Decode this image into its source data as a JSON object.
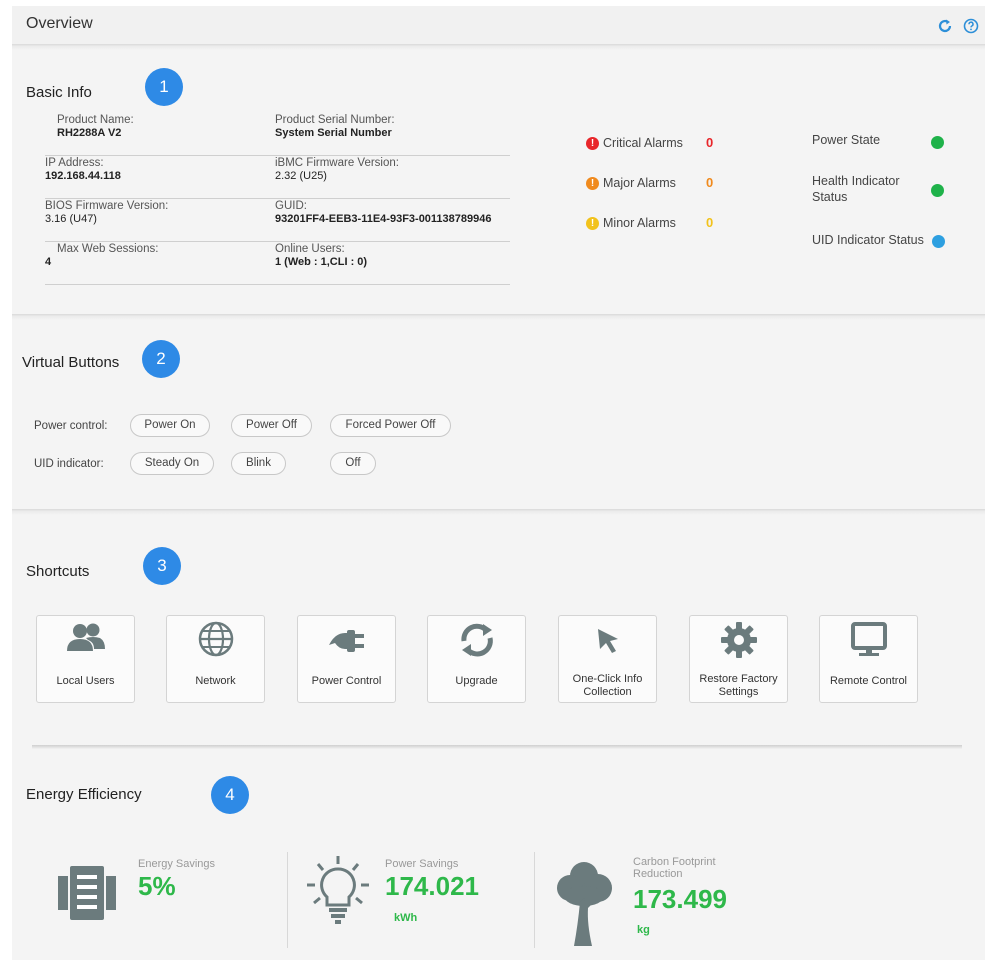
{
  "header": {
    "title": "Overview",
    "refresh_icon": "refresh-icon",
    "help_icon": "help-icon"
  },
  "basic_info": {
    "title": "Basic Info",
    "badge": "1",
    "fields": [
      {
        "label": "Product  Name:",
        "value": "RH2288A V2"
      },
      {
        "label": "Product Serial Number:",
        "value": "System Serial Number"
      },
      {
        "label": "IP Address:",
        "value": "192.168.44.118"
      },
      {
        "label": "iBMC Firmware Version:",
        "value": "2.32 (U25)"
      },
      {
        "label": "BIOS Firmware Version:",
        "value": "3.16 (U47)"
      },
      {
        "label": "GUID:",
        "value": "93201FF4-EEB3-11E4-93F3-001138789946"
      },
      {
        "label": "Max Web Sessions:",
        "value": "4"
      },
      {
        "label": "Online Users:",
        "value": "1 (Web : 1,CLI : 0)"
      }
    ],
    "alarms": [
      {
        "label": "Critical Alarms",
        "count": "0",
        "color": "#e8262a"
      },
      {
        "label": "Major Alarms",
        "count": "0",
        "color": "#f08a1d"
      },
      {
        "label": "Minor Alarms",
        "count": "0",
        "color": "#f2c21b"
      }
    ],
    "states": [
      {
        "label": "Power State",
        "color": "#1fb24a"
      },
      {
        "label": "Health Indicator Status",
        "color": "#1fb24a"
      },
      {
        "label": "UID Indicator Status",
        "color": "#2d9fe0"
      }
    ]
  },
  "virtual_buttons": {
    "title": "Virtual Buttons",
    "badge": "2",
    "power_label": "Power control:",
    "power_on": "Power On",
    "power_off": "Power Off",
    "forced_power_off": "Forced Power Off",
    "uid_label": "UID indicator:",
    "steady_on": "Steady On",
    "blink": "Blink",
    "off": "Off"
  },
  "shortcuts": {
    "title": "Shortcuts",
    "badge": "3",
    "items": [
      {
        "label": "Local Users",
        "icon": "users-icon"
      },
      {
        "label": "Network",
        "icon": "globe-icon"
      },
      {
        "label": "Power Control",
        "icon": "power-plug-icon"
      },
      {
        "label": "Upgrade",
        "icon": "sync-icon"
      },
      {
        "label": "One-Click Info Collection",
        "icon": "cursor-arrow-icon"
      },
      {
        "label": "Restore Factory Settings",
        "icon": "gear-icon"
      },
      {
        "label": "Remote Control",
        "icon": "monitor-icon"
      }
    ]
  },
  "energy": {
    "title": "Energy Efficiency",
    "badge": "4",
    "energy_savings_label": "Energy Savings",
    "energy_savings_value": "5%",
    "power_savings_label": "Power Savings",
    "power_savings_value": "174.021",
    "power_savings_unit": "kWh",
    "carbon_label": "Carbon Footprint Reduction",
    "carbon_value": "173.499",
    "carbon_unit": "kg"
  },
  "colors": {
    "badge": "#2e8ae6",
    "accent_green": "#2eb84a",
    "icon_gray": "#6b7b7d"
  }
}
